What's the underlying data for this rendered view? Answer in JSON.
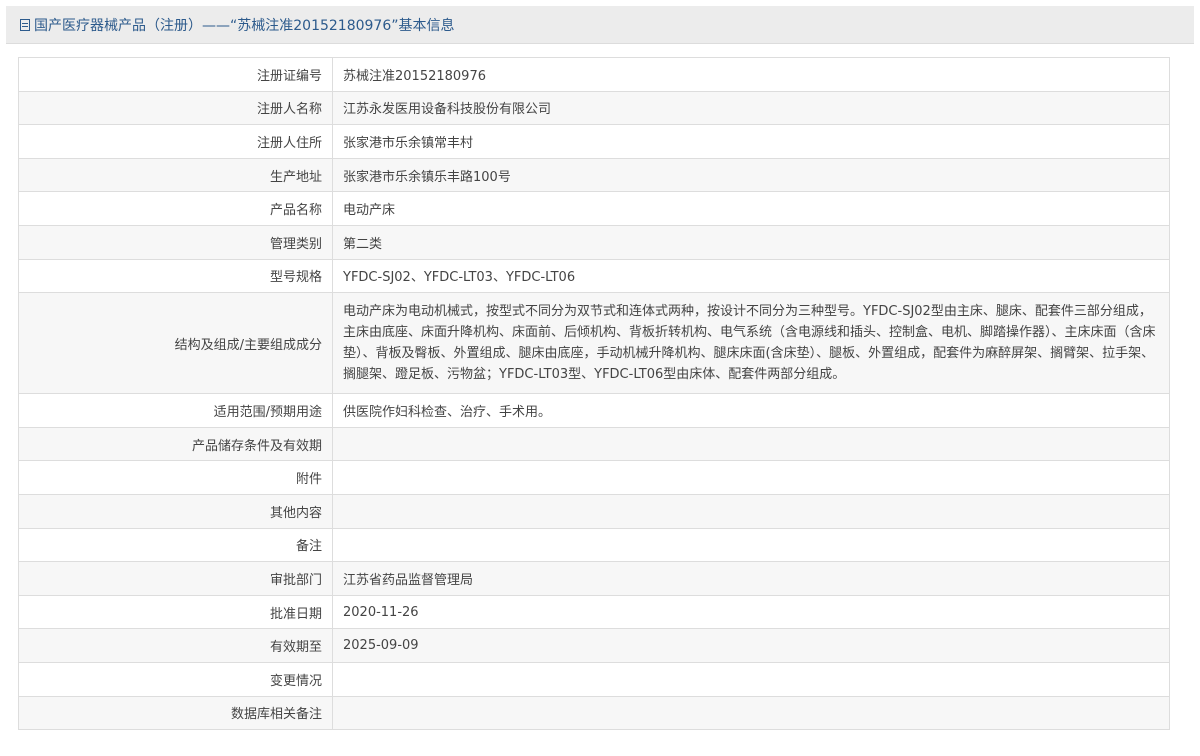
{
  "header": {
    "title": "国产医疗器械产品（注册）——“苏械注准20152180976”基本信息"
  },
  "rows": [
    {
      "label": "注册证编号",
      "value": "苏械注准20152180976"
    },
    {
      "label": "注册人名称",
      "value": "江苏永发医用设备科技股份有限公司"
    },
    {
      "label": "注册人住所",
      "value": "张家港市乐余镇常丰村"
    },
    {
      "label": "生产地址",
      "value": "张家港市乐余镇乐丰路100号"
    },
    {
      "label": "产品名称",
      "value": "电动产床"
    },
    {
      "label": "管理类别",
      "value": "第二类"
    },
    {
      "label": "型号规格",
      "value": "YFDC-SJ02、YFDC-LT03、YFDC-LT06"
    },
    {
      "label": "结构及组成/主要组成成分",
      "value": "电动产床为电动机械式，按型式不同分为双节式和连体式两种，按设计不同分为三种型号。YFDC-SJ02型由主床、腿床、配套件三部分组成，主床由底座、床面升降机构、床面前、后倾机构、背板折转机构、电气系统（含电源线和插头、控制盒、电机、脚踏操作器）、主床床面（含床垫）、背板及臀板、外置组成、腿床由底座，手动机械升降机构、腿床床面(含床垫）、腿板、外置组成，配套件为麻醉屏架、搁臂架、拉手架、搁腿架、蹬足板、污物盆；YFDC-LT03型、YFDC-LT06型由床体、配套件两部分组成。"
    },
    {
      "label": "适用范围/预期用途",
      "value": "供医院作妇科检查、治疗、手术用。"
    },
    {
      "label": "产品储存条件及有效期",
      "value": ""
    },
    {
      "label": "附件",
      "value": ""
    },
    {
      "label": "其他内容",
      "value": ""
    },
    {
      "label": "备注",
      "value": ""
    },
    {
      "label": "审批部门",
      "value": "江苏省药品监督管理局"
    },
    {
      "label": "批准日期",
      "value": "2020-11-26"
    },
    {
      "label": "有效期至",
      "value": "2025-09-09"
    },
    {
      "label": "变更情况",
      "value": ""
    },
    {
      "label": "数据库相关备注",
      "value": ""
    }
  ]
}
